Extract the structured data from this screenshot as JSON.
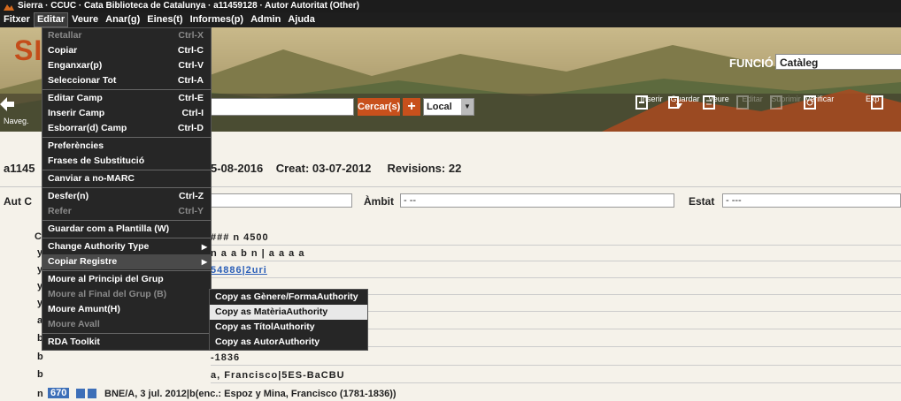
{
  "window": {
    "title": "Sierra · CCUC · Cata Biblioteca de Catalunya · a11459128 · Autor Autoritat (Other)"
  },
  "menubar": {
    "items": [
      "Fitxer",
      "Editar",
      "Veure",
      "Anar(g)",
      "Eines(t)",
      "Informes(p)",
      "Admin",
      "Ajuda"
    ]
  },
  "banner": {
    "logo": "SI",
    "funcio_label": "FUNCIÓ",
    "funcio_value": "Catàleg",
    "nav_label": "Naveg.",
    "search_button": "Cercar(s)",
    "plus": "+",
    "scope": "Local"
  },
  "toolbar": {
    "items": [
      {
        "label": "Inserir",
        "icon": "insert-icon",
        "enabled": true
      },
      {
        "label": "Guardar",
        "icon": "save-icon",
        "enabled": true
      },
      {
        "label": "Veure",
        "icon": "view-icon",
        "enabled": true
      },
      {
        "label": "Editar",
        "icon": "edit-icon",
        "enabled": false
      },
      {
        "label": "Suprimir",
        "icon": "delete-icon",
        "enabled": false
      },
      {
        "label": "Verificar",
        "icon": "verify-icon",
        "enabled": true
      },
      {
        "label": "Exp",
        "icon": "export-icon",
        "enabled": true
      }
    ]
  },
  "record": {
    "id_prefix": "a1145",
    "modified": "5-08-2016",
    "created": "Creat: 03-07-2012",
    "revisions": "Revisions: 22"
  },
  "fields": {
    "aut_label": "Aut C",
    "ambit_label": "Àmbit",
    "ambit_value": "- --",
    "estat_label": "Estat",
    "estat_value": "- ---"
  },
  "var_rows": [
    {
      "tag": "C",
      "val": "### n  4500"
    },
    {
      "tag": "y",
      "val": "n a a b n        | a  a a a"
    },
    {
      "tag": "y",
      "val": "54886|2uri"
    },
    {
      "tag": "y",
      "val": ""
    },
    {
      "tag": "y",
      "val": ""
    },
    {
      "tag": "a",
      "val": ""
    },
    {
      "tag": "b",
      "val": ""
    },
    {
      "tag": "b",
      "val": "-1836"
    },
    {
      "tag": "b",
      "val": "a, Francisco|5ES-BaCBU"
    }
  ],
  "bottom_row": {
    "tag": "n",
    "field": "670",
    "text": "BNE/A, 3 jul. 2012|b(enc.: Espoz y Mina, Francisco (1781-1836))"
  },
  "edit_menu": {
    "items": [
      {
        "label": "Retallar",
        "shortcut": "Ctrl-X",
        "dim": true
      },
      {
        "label": "Copiar",
        "shortcut": "Ctrl-C",
        "dim": false
      },
      {
        "label": "Enganxar(p)",
        "shortcut": "Ctrl-V",
        "dim": false
      },
      {
        "label": "Seleccionar Tot",
        "shortcut": "Ctrl-A",
        "dim": false
      },
      {
        "sep": true
      },
      {
        "label": "Editar Camp",
        "shortcut": "Ctrl-E",
        "dim": false
      },
      {
        "label": "Inserir Camp",
        "shortcut": "Ctrl-I",
        "dim": false
      },
      {
        "label": "Esborrar(d) Camp",
        "shortcut": "Ctrl-D",
        "dim": false
      },
      {
        "sep": true
      },
      {
        "label": "Preferències",
        "shortcut": "",
        "dim": false
      },
      {
        "label": "Frases de Substitució",
        "shortcut": "",
        "dim": false
      },
      {
        "sep": true
      },
      {
        "label": "Canviar a no-MARC",
        "shortcut": "",
        "dim": false
      },
      {
        "sep": true
      },
      {
        "label": "Desfer(n)",
        "shortcut": "Ctrl-Z",
        "dim": false
      },
      {
        "label": "Refer",
        "shortcut": "Ctrl-Y",
        "dim": true
      },
      {
        "sep": true
      },
      {
        "label": "Guardar com a Plantilla (W)",
        "shortcut": "",
        "dim": false
      },
      {
        "sep": true
      },
      {
        "label": "Change Authority Type",
        "shortcut": "",
        "dim": false,
        "submenu": true
      },
      {
        "label": "Copiar Registre",
        "shortcut": "",
        "dim": false,
        "submenu": true,
        "highlight": true
      },
      {
        "sep": true
      },
      {
        "label": "Moure al Principi del Grup",
        "shortcut": "",
        "dim": false
      },
      {
        "label": "Moure al Final del Grup (B)",
        "shortcut": "",
        "dim": true
      },
      {
        "label": "Moure Amunt(H)",
        "shortcut": "",
        "dim": false
      },
      {
        "label": "Moure Avall",
        "shortcut": "",
        "dim": true
      },
      {
        "sep": true
      },
      {
        "label": "RDA Toolkit",
        "shortcut": "",
        "dim": false
      }
    ]
  },
  "copy_submenu": {
    "items": [
      {
        "label": "Copy as Gènere/FormaAuthority",
        "highlight": false
      },
      {
        "label": "Copy as MatèriaAuthority",
        "highlight": true
      },
      {
        "label": "Copy as TítolAuthority",
        "highlight": false
      },
      {
        "label": "Copy as AutorAuthority",
        "highlight": false
      }
    ]
  }
}
